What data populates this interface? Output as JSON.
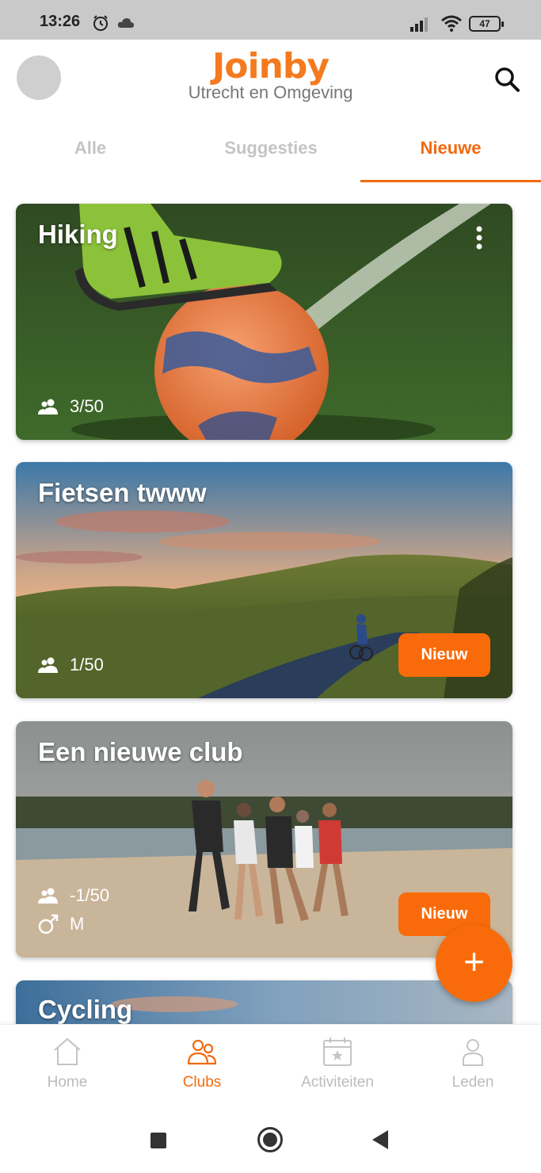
{
  "status_bar": {
    "time": "13:26",
    "battery": "47"
  },
  "header": {
    "logo": "Joinby",
    "region": "Utrecht en Omgeving"
  },
  "tabs": [
    {
      "label": "Alle",
      "active": false
    },
    {
      "label": "Suggesties",
      "active": false
    },
    {
      "label": "Nieuwe",
      "active": true
    }
  ],
  "clubs": [
    {
      "title": "Hiking",
      "members": "3/50",
      "badge": ""
    },
    {
      "title": "Fietsen twww",
      "members": "1/50",
      "badge": "Nieuw"
    },
    {
      "title": "Een nieuwe club",
      "members": "-1/50",
      "gender": "M",
      "badge": "Nieuw"
    },
    {
      "title": "Cycling"
    }
  ],
  "fab": {
    "label": "+"
  },
  "bottom_nav": [
    {
      "label": "Home",
      "icon": "home-icon",
      "active": false
    },
    {
      "label": "Clubs",
      "icon": "clubs-icon",
      "active": true
    },
    {
      "label": "Activiteiten",
      "icon": "calendar-icon",
      "active": false
    },
    {
      "label": "Leden",
      "icon": "person-icon",
      "active": false
    }
  ],
  "colors": {
    "accent": "#f06a10",
    "badge": "#f96b0a",
    "inactive": "#c4c4c4"
  }
}
